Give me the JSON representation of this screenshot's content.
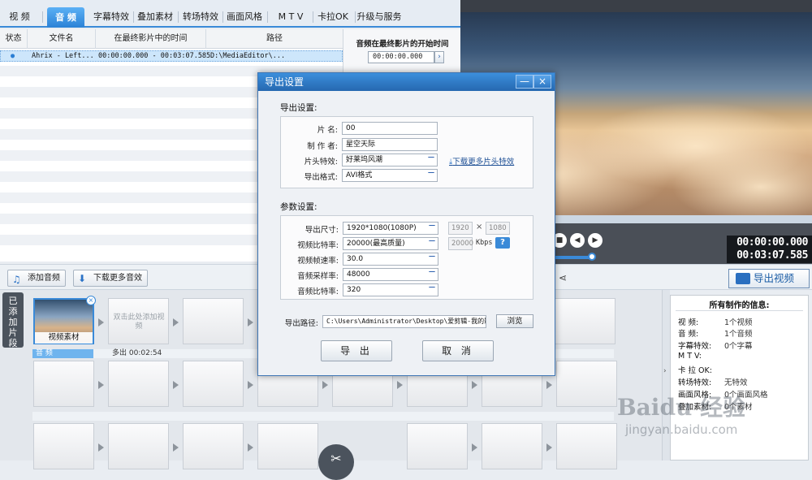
{
  "tabs": [
    "视 频",
    "音 频",
    "字幕特效",
    "叠加素材",
    "转场特效",
    "画面风格",
    "M T V",
    "卡拉OK",
    "升级与服务"
  ],
  "table": {
    "headers": [
      "状态",
      "文件名",
      "在最终影片中的时间",
      "路径"
    ],
    "row": {
      "status": "●",
      "filename": "Ahrix - Left...",
      "time": "00:00:00.000 - 00:03:07.585",
      "path": "D:\\MediaEditor\\..."
    }
  },
  "audio_start": {
    "label": "音频在最终影片的开始时间",
    "value": "00:00:00.000"
  },
  "player": {
    "current_time": "00:00:00.000",
    "total_time": "00:03:07.585"
  },
  "midbar": {
    "add_audio": "添加音频",
    "download_effects": "下载更多音效",
    "export_video": "导出视频"
  },
  "timeline": {
    "side_tab": "已添加片段",
    "clip_label": "视频素材",
    "add_hint": "双击此处添加视频",
    "audio_label": "音 频",
    "audio_extra": "多出 00:02:54"
  },
  "info": {
    "title": "所有制作的信息:",
    "rows": [
      {
        "k": "视    频:",
        "v": "1个视频"
      },
      {
        "k": "音    频:",
        "v": "1个音频"
      },
      {
        "k": "字幕特效:",
        "v": "0个字幕"
      },
      {
        "k": "M  T  V:",
        "v": ""
      },
      {
        "k": "卡 拉 OK:",
        "v": ""
      },
      {
        "k": "转场特效:",
        "v": "无特效"
      },
      {
        "k": "画面风格:",
        "v": "0个画面风格"
      },
      {
        "k": "叠加素材:",
        "v": "0个素材"
      }
    ]
  },
  "dialog": {
    "title": "导出设置",
    "export_section": "导出设置:",
    "name_label": "片    名:",
    "name_value": "00",
    "author_label": "制 作 者:",
    "author_value": "星空天际",
    "intro_label": "片头特效:",
    "intro_value": "好莱坞风潮",
    "download_intro": "下载更多片头特效",
    "format_label": "导出格式:",
    "format_value": "AVI格式",
    "param_section": "参数设置:",
    "size_label": "导出尺寸:",
    "size_value": "1920*1080(1080P)",
    "width": "1920",
    "height": "1080",
    "vbitrate_label": "视频比特率:",
    "vbitrate_value": "20000(最高质量)",
    "vbitrate_custom": "20000",
    "kbps": "Kbps",
    "fps_label": "视频帧速率:",
    "fps_value": "30.0",
    "asample_label": "音频采样率:",
    "asample_value": "48000",
    "abitrate_label": "音频比特率:",
    "abitrate_value": "320",
    "path_label": "导出路径:",
    "path_value": "C:\\Users\\Administrator\\Desktop\\爱剪辑-我的影片",
    "browse": "浏览",
    "ok": "导 出",
    "cancel": "取 消",
    "times": "×",
    "help": "?"
  },
  "watermark": {
    "brand": "Baidu 经验",
    "url": "jingyan.baidu.com"
  }
}
